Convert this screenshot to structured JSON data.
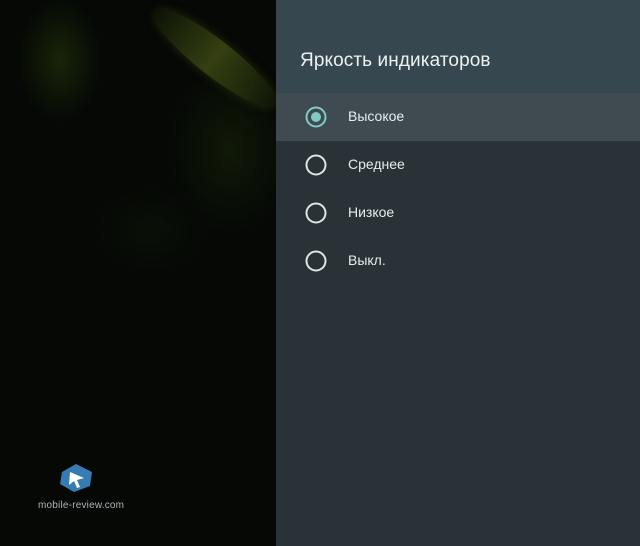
{
  "dialog": {
    "title": "Яркость индикаторов",
    "options": [
      {
        "label": "Высокое",
        "selected": true
      },
      {
        "label": "Среднее",
        "selected": false
      },
      {
        "label": "Низкое",
        "selected": false
      },
      {
        "label": "Выкл.",
        "selected": false
      }
    ]
  },
  "watermark": {
    "text": "mobile-review.com"
  },
  "colors": {
    "panel_background": "#293237",
    "header_background": "#37474f",
    "selected_row": "#3f4b51",
    "radio_accent": "#80cbc4",
    "radio_outline": "#dfe4e6"
  },
  "icons": {
    "selected": "radio-checked-icon",
    "unselected": "radio-unchecked-icon",
    "watermark": "mobile-review-logo-icon"
  }
}
